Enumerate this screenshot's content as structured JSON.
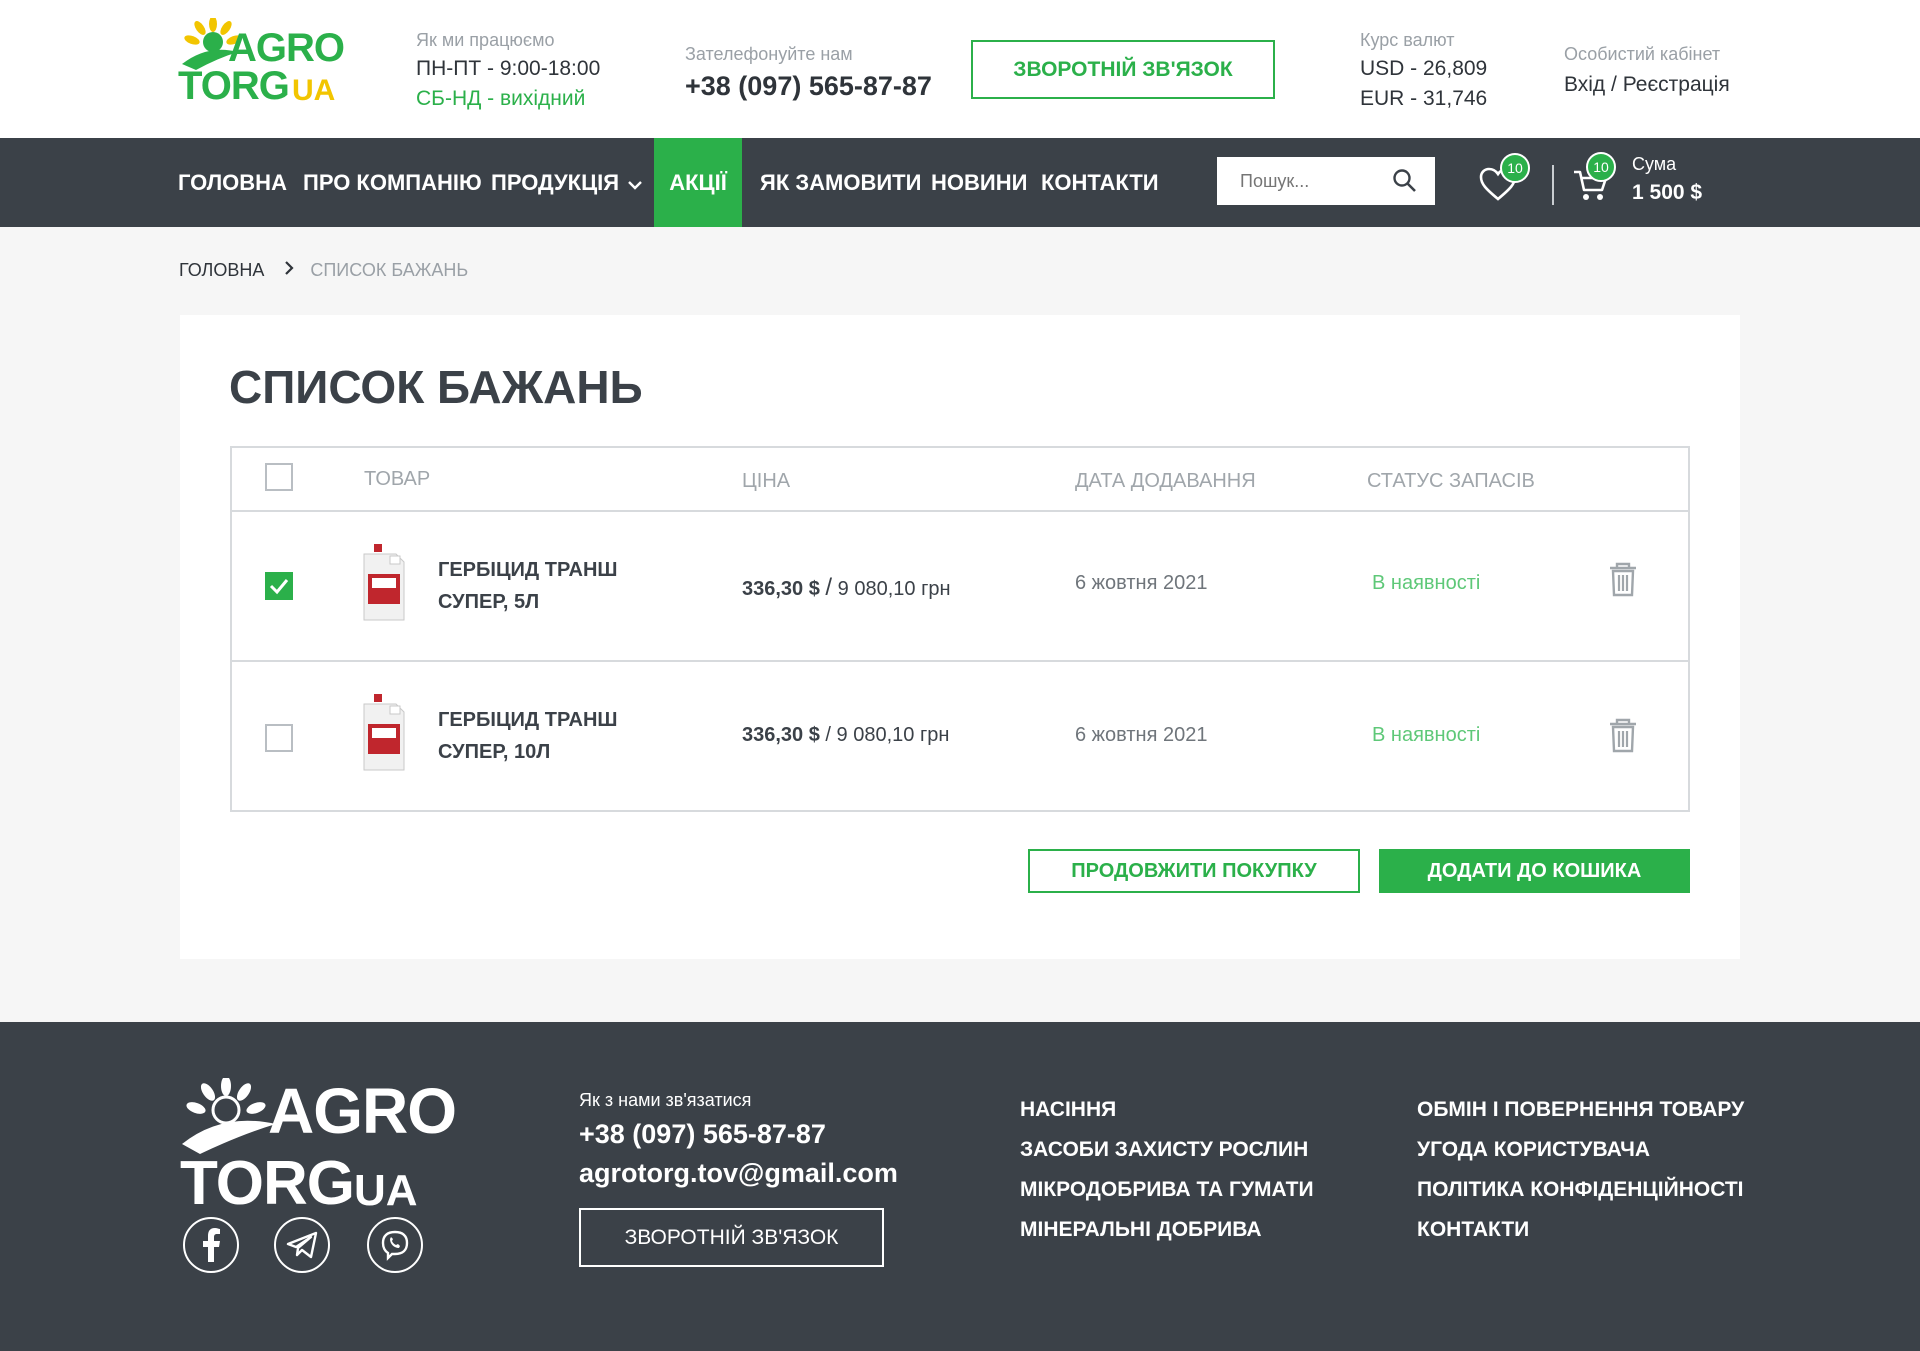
{
  "header": {
    "logo": {
      "line1": "AGRO",
      "line2": "TORG",
      "line3": "UA"
    },
    "hours": {
      "label": "Як ми працюємо",
      "weekdays": "ПН-ПТ - 9:00-18:00",
      "weekend": "СБ-НД - вихідний"
    },
    "phone": {
      "label": "Зателефонуйте нам",
      "number": "+38 (097) 565-87-87"
    },
    "callback_label": "ЗВОРОТНІЙ ЗВ'ЯЗОК",
    "currency": {
      "label": "Курс валют",
      "usd": "USD - 26,809",
      "eur": "EUR - 31,746"
    },
    "cabinet": {
      "label": "Особистий кабінет",
      "link": "Вхід / Реєстрація"
    }
  },
  "nav": {
    "items": [
      {
        "label": "ГОЛОВНА"
      },
      {
        "label": "ПРО КОМПАНІЮ"
      },
      {
        "label": "ПРОДУКЦІЯ"
      },
      {
        "label": "АКЦІЇ",
        "active": true
      },
      {
        "label": "ЯК ЗАМОВИТИ"
      },
      {
        "label": "НОВИНИ"
      },
      {
        "label": "КОНТАКТИ"
      }
    ],
    "search_placeholder": "Пошук...",
    "wishlist_count": "10",
    "cart_count": "10",
    "cart_sum_label": "Сума",
    "cart_sum_value": "1 500 $"
  },
  "breadcrumb": {
    "home": "ГОЛОВНА",
    "current": "СПИСОК БАЖАНЬ"
  },
  "wishlist": {
    "title": "СПИСОК БАЖАНЬ",
    "columns": {
      "product": "ТОВАР",
      "price": "ЦІНА",
      "date": "ДАТА ДОДАВАННЯ",
      "stock": "СТАТУС ЗАПАСІВ"
    },
    "rows": [
      {
        "checked": true,
        "name": "ГЕРБІЦИД ТРАНШ СУПЕР, 5Л",
        "price_usd": "336,30 $",
        "price_uah": "9 080,10 грн",
        "date": "6 жовтня 2021",
        "stock": "В наявності"
      },
      {
        "checked": false,
        "name": "ГЕРБІЦИД ТРАНШ СУПЕР, 10Л",
        "price_usd": "336,30 $",
        "price_uah": "9 080,10 грн",
        "date": "6 жовтня 2021",
        "stock": "В наявності"
      }
    ],
    "continue_label": "ПРОДОВЖИТИ ПОКУПКУ",
    "add_to_cart_label": "ДОДАТИ ДО КОШИКА"
  },
  "footer": {
    "logo": {
      "line1": "AGRO",
      "line2": "TORG",
      "line3": "UA"
    },
    "contact_label": "Як з нами зв'язатися",
    "phone": "+38 (097) 565-87-87",
    "email": "agrotorg.tov@gmail.com",
    "callback_label": "ЗВОРОТНІЙ ЗВ'ЯЗОК",
    "col1": [
      "НАСІННЯ",
      "ЗАСОБИ ЗАХИСТУ РОСЛИН",
      "МІКРОДОБРИВА ТА ГУМАТИ",
      "МІНЕРАЛЬНІ ДОБРИВА"
    ],
    "col2": [
      "ОБМІН І ПОВЕРНЕННЯ ТОВАРУ",
      "УГОДА КОРИСТУВАЧА",
      "ПОЛІТИКА КОНФІДЕНЦІЙНОСТІ",
      "КОНТАКТИ"
    ],
    "social": [
      "facebook-icon",
      "telegram-icon",
      "viber-icon"
    ]
  },
  "colors": {
    "brand_green": "#2bb04a",
    "dark": "#3b4148",
    "logo_yellow": "#f2c500"
  }
}
